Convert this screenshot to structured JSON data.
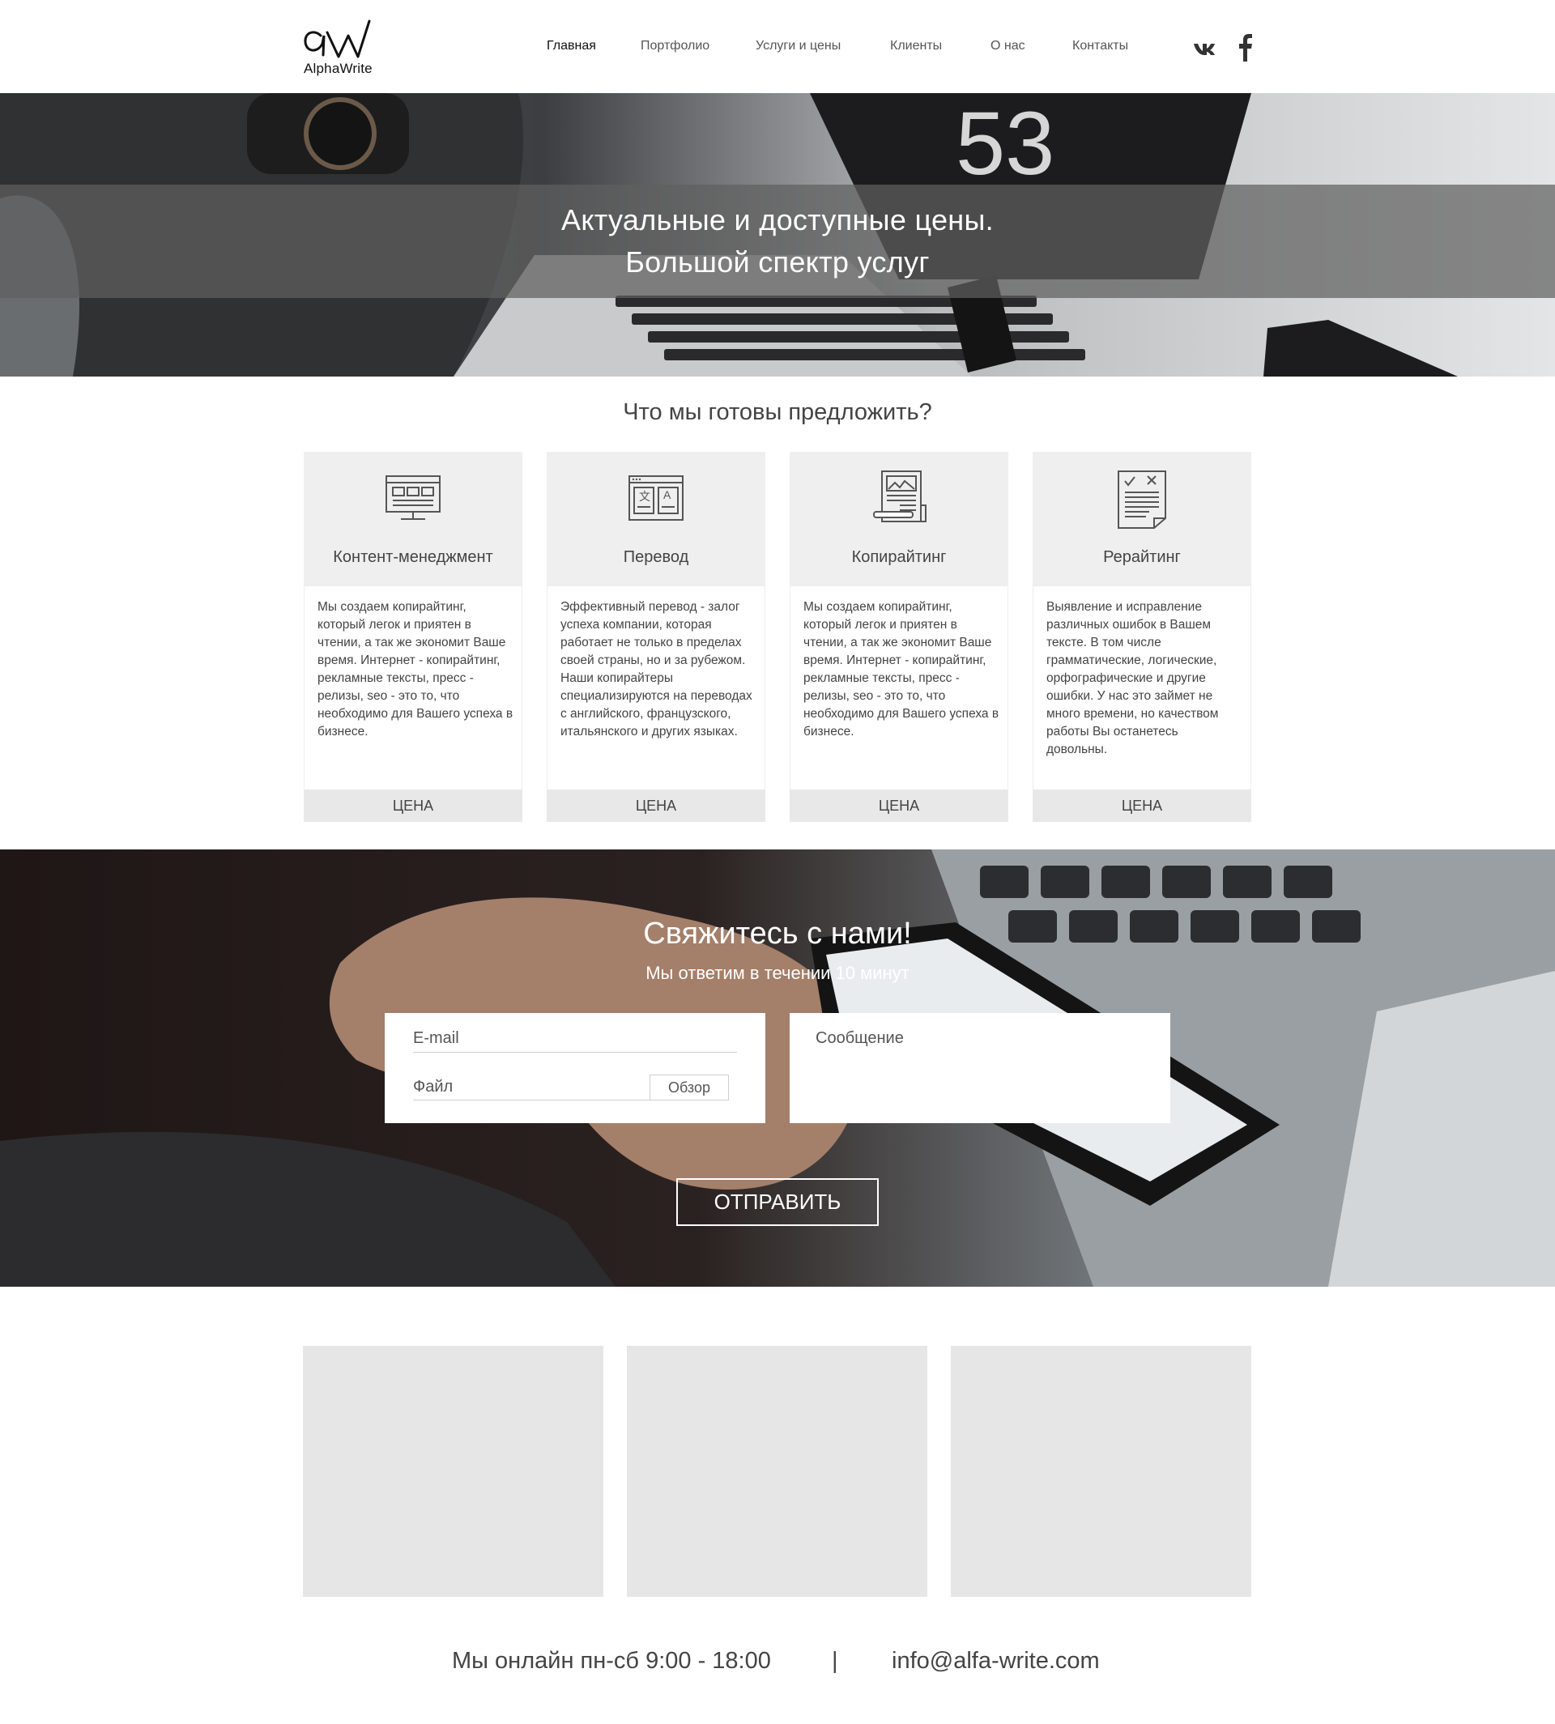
{
  "header": {
    "logo_text": "AlphaWrite",
    "nav": [
      {
        "label": "Главная",
        "active": true
      },
      {
        "label": "Портфолио",
        "active": false
      },
      {
        "label": "Услуги и цены",
        "active": false
      },
      {
        "label": "Клиенты",
        "active": false
      },
      {
        "label": "О нас",
        "active": false
      },
      {
        "label": "Контакты",
        "active": false
      }
    ],
    "social": [
      "vk-icon",
      "facebook-icon"
    ]
  },
  "hero": {
    "line1": "Актуальные и доступные цены.",
    "line2": "Большой спектр услуг",
    "watch_digits": "53"
  },
  "offer": {
    "heading": "Что мы готовы предложить?",
    "cards": [
      {
        "icon": "monitor-icon",
        "title": "Контент-менеджмент",
        "text": "Мы создаем копирайтинг, который легок и приятен в чтении, а так же экономит Ваше время. Интернет - копирайтинг, рекламные тексты, пресс - релизы, seo - это то, что необходимо для Вашего успеха в бизнесе.",
        "price": "ЦЕНА"
      },
      {
        "icon": "translate-icon",
        "title": "Перевод",
        "text": "Эффективный перевод - залог успеха компании, которая работает не только в пределах своей страны, но и за рубежом. Наши копирайтеры специализируются на переводах с английского, французского, итальянского и других языках.",
        "price": "ЦЕНА"
      },
      {
        "icon": "copywriting-icon",
        "title": "Копирайтинг",
        "text": "Мы создаем копирайтинг, который легок и приятен в чтении, а так же экономит Ваше время. Интернет - копирайтинг, рекламные тексты, пресс - релизы, seo - это то, что необходимо для Вашего успеха в бизнесе.",
        "price": "ЦЕНА"
      },
      {
        "icon": "checklist-icon",
        "title": "Рерайтинг",
        "text": "Выявление и исправление различных ошибок в Вашем тексте. В том числе грамматические, логические, орфографические и другие ошибки. У нас это займет не много времени, но качеством работы Вы останетесь довольны.",
        "price": "ЦЕНА"
      }
    ]
  },
  "contact": {
    "title": "Свяжитесь с нами!",
    "subtitle": "Мы ответим в течении 10 минут",
    "email_label": "E-mail",
    "file_label": "Файл",
    "browse_label": "Обзор",
    "message_label": "Сообщение",
    "submit_label": "ОТПРАВИТЬ"
  },
  "footer": {
    "hours": "Мы онлайн пн-сб 9:00 - 18:00",
    "separator": "|",
    "email": "info@alfa-write.com"
  }
}
